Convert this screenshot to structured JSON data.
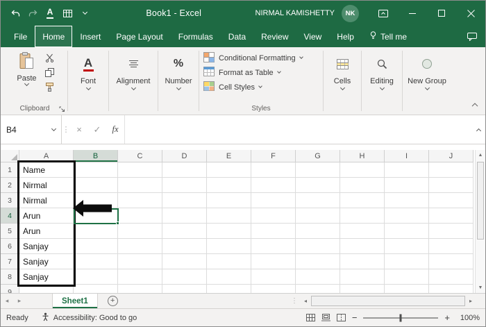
{
  "title_bar": {
    "title": "Book1 - Excel",
    "user": {
      "name": "NIRMAL KAMISHETTY",
      "initials": "NK"
    }
  },
  "ribbon_tabs": {
    "items": [
      {
        "label": "File",
        "active": false
      },
      {
        "label": "Home",
        "active": true
      },
      {
        "label": "Insert",
        "active": false
      },
      {
        "label": "Page Layout",
        "active": false
      },
      {
        "label": "Formulas",
        "active": false
      },
      {
        "label": "Data",
        "active": false
      },
      {
        "label": "Review",
        "active": false
      },
      {
        "label": "View",
        "active": false
      },
      {
        "label": "Help",
        "active": false
      },
      {
        "label": "Tell me",
        "active": false,
        "icon": "lightbulb-icon"
      }
    ]
  },
  "ribbon": {
    "clipboard": {
      "paste": "Paste",
      "group_label": "Clipboard"
    },
    "font": {
      "label": "Font"
    },
    "alignment": {
      "label": "Alignment"
    },
    "number": {
      "label": "Number"
    },
    "styles": {
      "conditional_formatting": "Conditional Formatting",
      "format_as_table": "Format as Table",
      "cell_styles": "Cell Styles",
      "group_label": "Styles"
    },
    "cells": {
      "label": "Cells"
    },
    "editing": {
      "label": "Editing"
    },
    "new_group": {
      "label": "New Group"
    }
  },
  "formula_bar": {
    "name_box": "B4",
    "fx": "fx",
    "formula": ""
  },
  "grid": {
    "columns": [
      "A",
      "B",
      "C",
      "D",
      "E",
      "F",
      "G",
      "H",
      "I",
      "J"
    ],
    "row_numbers": [
      "1",
      "2",
      "3",
      "4",
      "5",
      "6",
      "7",
      "8",
      "9"
    ],
    "column_a_values": [
      "Name",
      "Nirmal",
      "Nirmal",
      "Arun",
      "Arun",
      "Sanjay",
      "Sanjay",
      "Sanjay",
      ""
    ],
    "selected_cell": "B4",
    "highlighted_column": "B",
    "highlighted_row": "4",
    "highlighted_range": "A1:A8"
  },
  "sheet_bar": {
    "active_sheet": "Sheet1"
  },
  "status_bar": {
    "ready": "Ready",
    "accessibility": "Accessibility: Good to go",
    "zoom": "100%"
  },
  "colors": {
    "excel_green": "#1e6a43",
    "accent_green": "#217346",
    "ribbon_bg": "#f3f2f1",
    "annotation_black": "#0d0d0d",
    "font_underline_red": "#c00000"
  }
}
